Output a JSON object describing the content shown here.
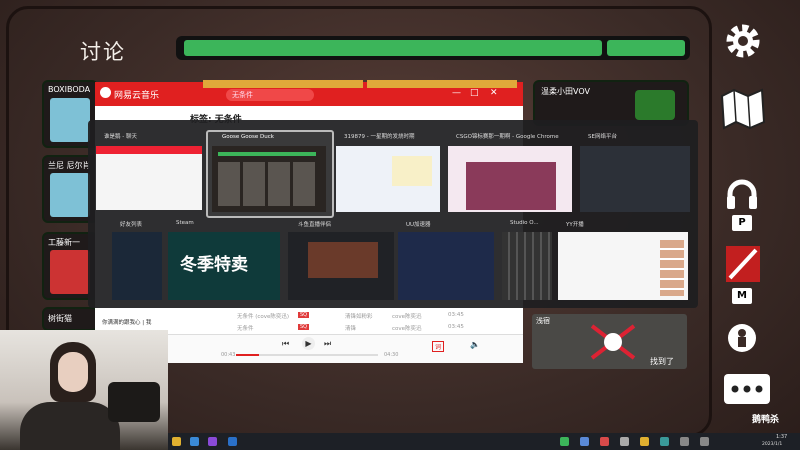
{
  "game": {
    "discussion_title": "讨论",
    "players": [
      {
        "name": "BOXIBODA"
      },
      {
        "name": "兰尼 尼尔肖"
      },
      {
        "name": "工藤新一"
      },
      {
        "name": "树街猫"
      },
      {
        "name": "温柔小田VOV"
      },
      {
        "name": "浅宿"
      }
    ],
    "hotkeys": {
      "push_to_talk": "P",
      "mute": "M"
    },
    "found_label": "找到了",
    "brand_label": "鹅鸭杀"
  },
  "music_app": {
    "title": "网易云音乐",
    "search_placeholder": "无条件",
    "song_title": "标签: 无条件",
    "rows": [
      {
        "title": "无条件 (cove陈奕迅)",
        "tag": "SQ",
        "artist": "清锋如粉彩",
        "album": "cove陈奕迅",
        "duration": "03:45"
      },
      {
        "title": "无条件",
        "tag": "SQ",
        "artist": "清锋",
        "album": "cove陈奕迅",
        "duration": "03:45"
      }
    ],
    "current_time": "00:43",
    "total_time": "04:30",
    "lyrics_btn": "词",
    "now_playing": "你满满的跟我心 | 我"
  },
  "alt_tab": {
    "windows_row1": [
      {
        "title": "谁是鹅 - 聊天"
      },
      {
        "title": "Goose Goose Duck"
      },
      {
        "title": "319879 - 一星期的发烧时期"
      },
      {
        "title": "CSGO锦标赛那一期啊 - Google Chrome"
      },
      {
        "title": "SE网络平台"
      }
    ],
    "windows_row2": [
      {
        "title": "好友列表"
      },
      {
        "title": "Steam"
      },
      {
        "title": "斗鱼直播伴侣"
      },
      {
        "title": "UU加速器"
      },
      {
        "title": "Studio O..."
      },
      {
        "title": "YY开播"
      }
    ],
    "steam_banner": "冬季特卖"
  },
  "taskbar": {
    "time": "1:37",
    "date": "2023/1/1"
  },
  "colors": {
    "timer_green": "#3cb55a",
    "netease_red": "#e02020",
    "overlay_bg": "#1e1e20"
  }
}
